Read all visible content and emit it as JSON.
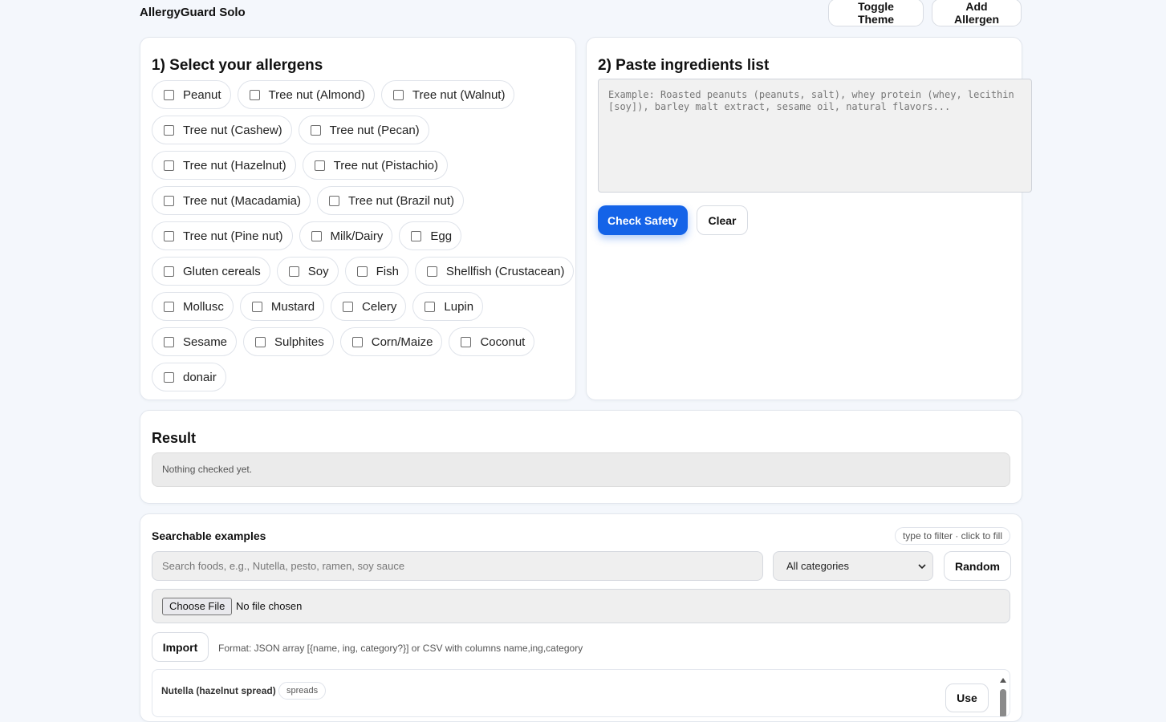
{
  "app": {
    "title": "AllergyGuard Solo",
    "toggle_theme_label": "Toggle Theme",
    "add_allergen_label": "Add Allergen"
  },
  "allergens": {
    "heading": "1) Select your allergens",
    "rows": [
      [
        {
          "label": "Peanut",
          "checked": false
        },
        {
          "label": "Tree nut (Almond)",
          "checked": false
        },
        {
          "label": "Tree nut (Walnut)",
          "checked": false
        }
      ],
      [
        {
          "label": "Tree nut (Cashew)",
          "checked": false
        },
        {
          "label": "Tree nut (Pecan)",
          "checked": false
        }
      ],
      [
        {
          "label": "Tree nut (Hazelnut)",
          "checked": false
        },
        {
          "label": "Tree nut (Pistachio)",
          "checked": false
        }
      ],
      [
        {
          "label": "Tree nut (Macadamia)",
          "checked": false
        },
        {
          "label": "Tree nut (Brazil nut)",
          "checked": false
        }
      ],
      [
        {
          "label": "Tree nut (Pine nut)",
          "checked": false
        },
        {
          "label": "Milk/Dairy",
          "checked": false
        },
        {
          "label": "Egg",
          "checked": false
        }
      ],
      [
        {
          "label": "Gluten cereals",
          "checked": false
        },
        {
          "label": "Soy",
          "checked": false
        },
        {
          "label": "Fish",
          "checked": false
        },
        {
          "label": "Shellfish (Crustacean)",
          "checked": false
        }
      ],
      [
        {
          "label": "Mollusc",
          "checked": false
        },
        {
          "label": "Mustard",
          "checked": false
        },
        {
          "label": "Celery",
          "checked": false
        },
        {
          "label": "Lupin",
          "checked": false
        }
      ],
      [
        {
          "label": "Sesame",
          "checked": false
        },
        {
          "label": "Sulphites",
          "checked": false
        },
        {
          "label": "Corn/Maize",
          "checked": false
        },
        {
          "label": "Coconut",
          "checked": false
        }
      ],
      [
        {
          "label": "donair",
          "checked": false
        }
      ]
    ]
  },
  "ingredients": {
    "heading": "2) Paste ingredients list",
    "placeholder": "Example: Roasted peanuts (peanuts, salt), whey protein (whey, lecithin [soy]), barley malt extract, sesame oil, natural flavors...",
    "value": "",
    "check_label": "Check Safety",
    "clear_label": "Clear"
  },
  "result": {
    "heading": "Result",
    "message": "Nothing checked yet."
  },
  "examples": {
    "heading": "Searchable examples",
    "hint": "type to filter · click to fill",
    "search_placeholder": "Search foods, e.g., Nutella, pesto, ramen, soy sauce",
    "category_selected": "All categories",
    "random_label": "Random",
    "file_button_label": "Choose File",
    "file_status": "No file chosen",
    "import_label": "Import",
    "import_note": "Format: JSON array [{name, ing, category?}] or CSV with columns name,ing,category",
    "items": [
      {
        "name": "Nutella (hazelnut spread)",
        "category": "spreads",
        "use_label": "Use"
      }
    ]
  },
  "colors": {
    "accent": "#1463e8",
    "background": "#f4f7fc",
    "panel": "#ffffff"
  }
}
